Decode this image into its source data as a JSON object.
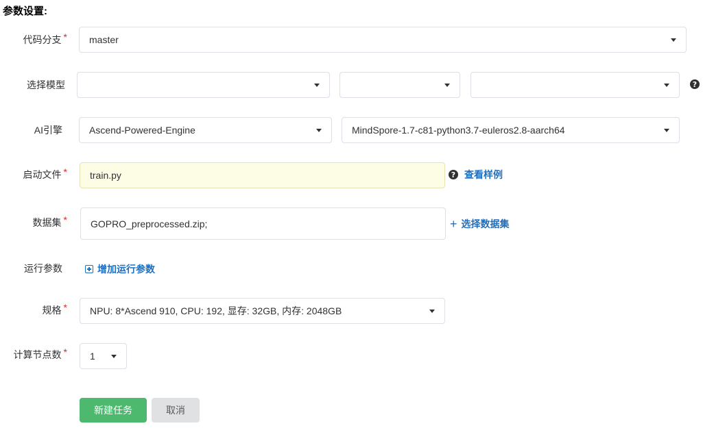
{
  "section": {
    "title": "参数设置:"
  },
  "branch": {
    "label": "代码分支",
    "required": "*",
    "value": "master"
  },
  "model": {
    "label": "选择模型",
    "select1": "",
    "select2": "",
    "select3": ""
  },
  "engine": {
    "label": "AI引擎",
    "engine_value": "Ascend-Powered-Engine",
    "image_value": "MindSpore-1.7-c81-python3.7-euleros2.8-aarch64"
  },
  "bootfile": {
    "label": "启动文件",
    "required": "*",
    "value": "train.py",
    "help_glyph": "?",
    "example_link": "查看样例"
  },
  "dataset": {
    "label": "数据集",
    "required": "*",
    "value": "GOPRO_preprocessed.zip;",
    "select_link_icon": "+",
    "select_link": "选择数据集"
  },
  "run_params": {
    "label": "运行参数",
    "add_link": "增加运行参数"
  },
  "spec": {
    "label": "规格",
    "required": "*",
    "value": "NPU: 8*Ascend 910, CPU: 192, 显存: 32GB, 内存: 2048GB"
  },
  "nodes": {
    "label": "计算节点数",
    "required": "*",
    "value": "1"
  },
  "actions": {
    "create": "新建任务",
    "cancel": "取消"
  },
  "icons": {
    "help": "question-circle-icon",
    "plus": "plus-icon",
    "plus_square": "plus-square-icon",
    "caret": "caret-down-icon"
  },
  "colors": {
    "primary_button": "#4cb96f",
    "link": "#1f6fbf",
    "required": "#db2828",
    "highlight_input": "#fdfde6"
  }
}
